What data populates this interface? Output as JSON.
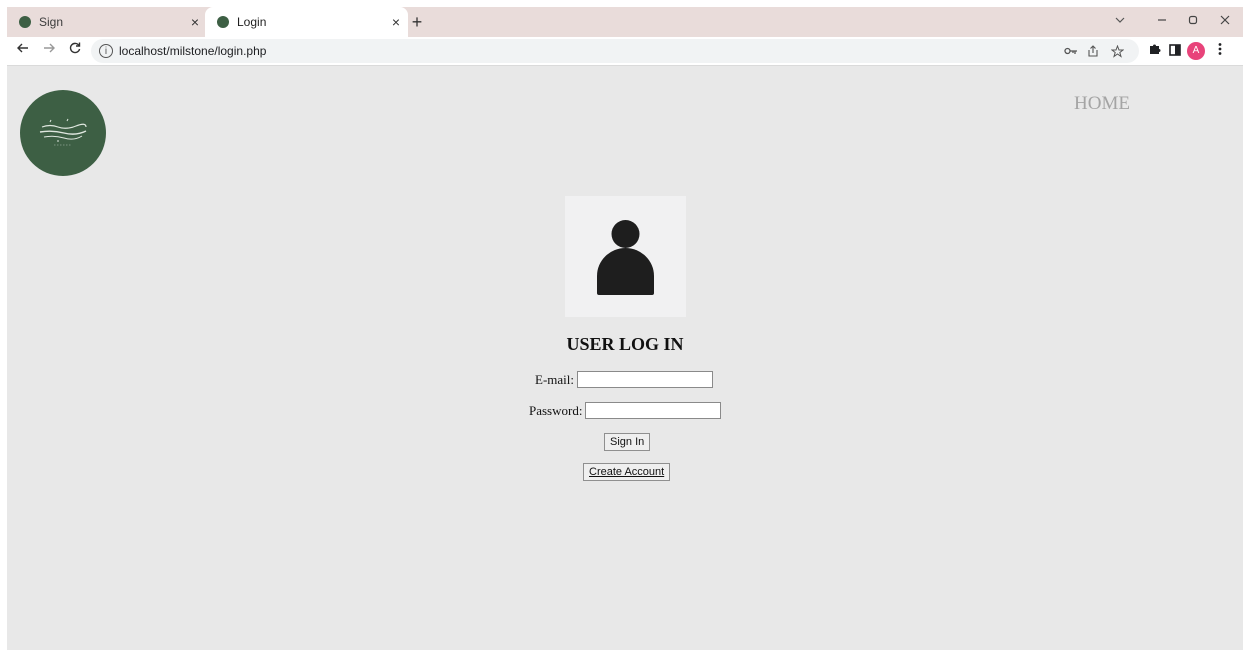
{
  "browser": {
    "tabs": [
      {
        "label": "Sign",
        "close": "×"
      },
      {
        "label": "Login",
        "close": "×"
      }
    ],
    "new_tab": "+",
    "url": "localhost/milstone/login.php"
  },
  "nav": {
    "home_label": "HOME"
  },
  "login": {
    "title": "USER LOG IN",
    "email_label": "E-mail:",
    "email_value": "",
    "password_label": "Password:",
    "password_value": "",
    "signin_label": "Sign In",
    "create_account_label": "Create Account"
  },
  "profile": {
    "initial": "A",
    "color": "#e8437a"
  },
  "colors": {
    "accent": "#3d5f44",
    "page_bg": "#e8e8e8",
    "tab_strip": "#e9dcda"
  }
}
